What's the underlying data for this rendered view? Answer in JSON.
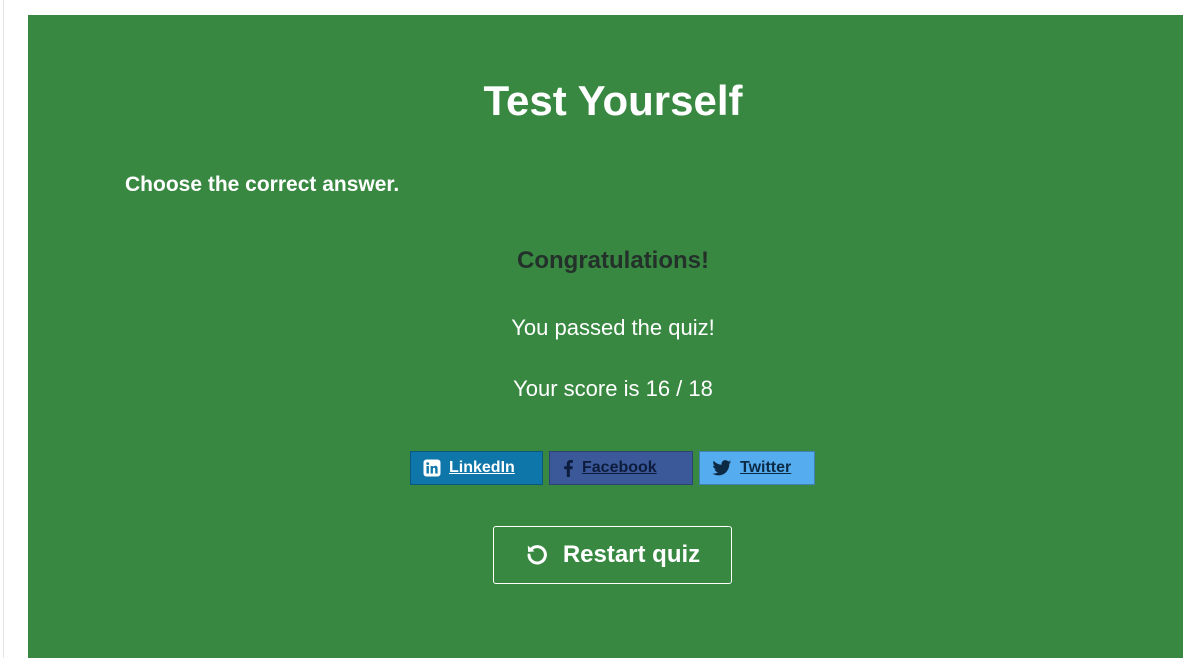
{
  "quiz": {
    "title": "Test Yourself",
    "instruction": "Choose the correct answer.",
    "result": {
      "heading": "Congratulations!",
      "message": "You passed the quiz!",
      "score_text": "Your score is 16 / 18",
      "score": 16,
      "total": 18
    },
    "share": {
      "linkedin_label": "LinkedIn",
      "facebook_label": "Facebook",
      "twitter_label": "Twitter"
    },
    "restart_label": "Restart quiz",
    "colors": {
      "panel_background": "#388842",
      "linkedin": "#0e76a8",
      "facebook": "#3b5998",
      "twitter": "#55acee"
    },
    "icons": {
      "linkedin": "linkedin-icon",
      "facebook": "facebook-icon",
      "twitter": "twitter-icon",
      "restart": "restart-icon"
    }
  }
}
